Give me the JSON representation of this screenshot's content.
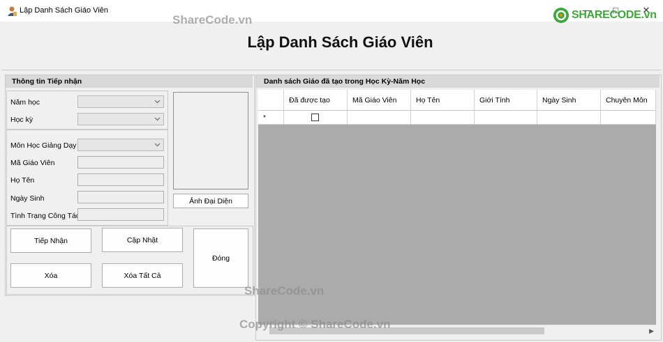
{
  "window": {
    "title": "Lập Danh Sách Giáo Viên"
  },
  "heading": "Lập Danh Sách Giáo Viên",
  "left_panel": {
    "header": "Thông tin Tiếp nhận",
    "fields": {
      "nam_hoc": "Năm học",
      "hoc_ky": "Học kỳ",
      "mon_hoc": "Môn Học Giảng Dạy",
      "ma_gv": "Mã Giáo Viên",
      "ho_ten": "Họ Tên",
      "ngay_sinh": "Ngày Sinh",
      "tinh_trang": "Tình Trạng Công Tác"
    },
    "photo_button": "Ảnh Đại Diện",
    "buttons": {
      "tiep_nhan": "Tiếp Nhận",
      "cap_nhat": "Cập Nhật",
      "dong": "Đóng",
      "xoa": "Xóa",
      "xoa_tat_ca": "Xóa Tất Cả"
    }
  },
  "right_panel": {
    "header": "Danh sách Giáo đã tạo trong Học Kỳ-Năm Học",
    "columns": [
      "Đã được tạo",
      "Mã Giáo Viên",
      "Họ Tên",
      "Giới Tính",
      "Ngày Sinh",
      "Chuyên Môn"
    ],
    "new_row_marker": "*"
  },
  "watermarks": {
    "logo_text": "SHARECODE.vn",
    "top": "ShareCode.vn",
    "middle": "ShareCode.vn",
    "bottom": "Copyright © ShareCode.vn"
  },
  "icons": [
    "user-app-icon",
    "minimize-icon",
    "maximize-icon",
    "close-icon",
    "chevron-down-icon",
    "checkbox-icon",
    "scroll-right-icon"
  ],
  "colors": {
    "accent_green": "#3aa935",
    "logo_orange": "#f08a1c",
    "grid_background": "#ababab",
    "group_header": "#d9d9d9"
  }
}
